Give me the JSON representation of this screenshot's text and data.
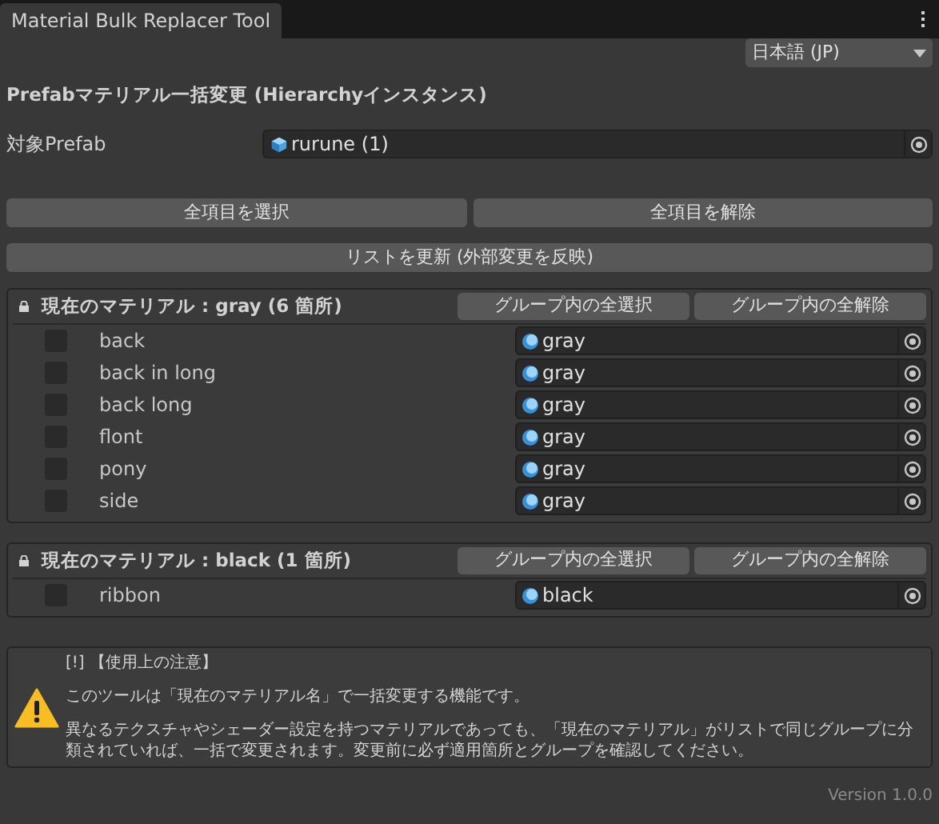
{
  "tab": {
    "title": "Material Bulk Replacer Tool"
  },
  "language": {
    "value": "日本語 (JP)"
  },
  "heading": "Prefabマテリアル一括変更 (Hierarchyインスタンス)",
  "target": {
    "label": "対象Prefab",
    "value": "rurune (1)"
  },
  "buttons": [
    "全項目を選択",
    "全項目を解除"
  ],
  "refresh_button": "リストを更新 (外部変更を反映)",
  "groups": [
    {
      "title": "現在のマテリアル : gray (6 箇所)",
      "select_all": "グループ内の全選択",
      "deselect_all": "グループ内の全解除",
      "rows": [
        {
          "name": "back",
          "checked": false,
          "material": "gray"
        },
        {
          "name": "back in long",
          "checked": false,
          "material": "gray"
        },
        {
          "name": "back long",
          "checked": false,
          "material": "gray"
        },
        {
          "name": "flont",
          "checked": false,
          "material": "gray"
        },
        {
          "name": "pony",
          "checked": false,
          "material": "gray"
        },
        {
          "name": "side",
          "checked": false,
          "material": "gray"
        }
      ]
    },
    {
      "title": "現在のマテリアル : black (1 箇所)",
      "select_all": "グループ内の全選択",
      "deselect_all": "グループ内の全解除",
      "rows": [
        {
          "name": "ribbon",
          "checked": false,
          "material": "black"
        }
      ]
    }
  ],
  "note": {
    "title": "[!] 【使用上の注意】",
    "paragraphs": [
      "このツールは「現在のマテリアル名」で一括変更する機能です。",
      "異なるテクスチャやシェーダー設定を持つマテリアルであっても、「現在のマテリアル」がリストで同じグループに分類されていれば、一括で変更されます。変更前に必ず適用箇所とグループを確認してください。"
    ]
  },
  "version": "Version 1.0.0"
}
